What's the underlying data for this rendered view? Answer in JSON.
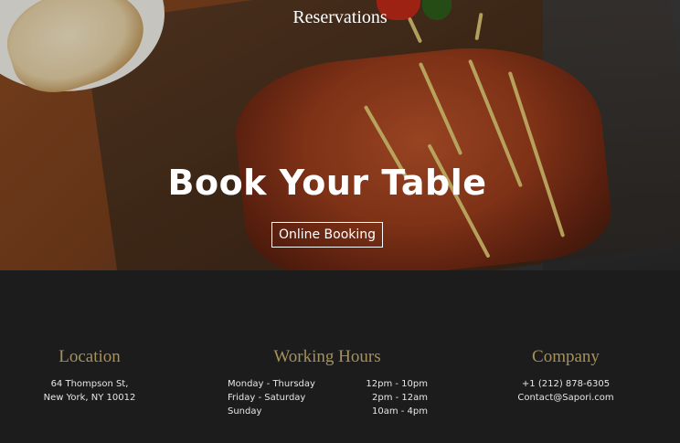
{
  "header": {
    "title": "Reservations"
  },
  "hero": {
    "headline": "Book Your Table",
    "cta_label": "Online Booking"
  },
  "footer": {
    "location": {
      "title": "Location",
      "lines": [
        "64 Thompson St,",
        "New York, NY 10012"
      ]
    },
    "hours": {
      "title": "Working Hours",
      "rows": [
        {
          "days": "Monday - Thursday",
          "time": "12pm - 10pm"
        },
        {
          "days": "Friday - Saturday",
          "time": "2pm - 12am"
        },
        {
          "days": "Sunday",
          "time": "10am - 4pm"
        }
      ]
    },
    "company": {
      "title": "Company",
      "phone": "+1 (212) 878-6305",
      "email": "Contact@Sapori.com"
    }
  },
  "colors": {
    "accent_gold": "#a6915a",
    "footer_bg": "#1c1c1c",
    "text_light": "#e6e6e6"
  }
}
